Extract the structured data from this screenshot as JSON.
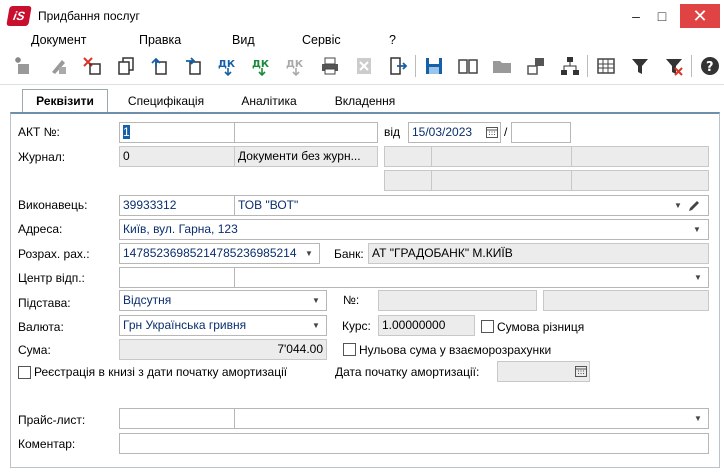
{
  "window": {
    "title": "Придбання послуг",
    "logo": "iS",
    "minimize": "–",
    "maximize": "□",
    "close": "✕"
  },
  "menu": [
    "Документ",
    "Правка",
    "Вид",
    "Сервіс",
    "?"
  ],
  "tabs": [
    "Реквізити",
    "Специфікація",
    "Аналітика",
    "Вкладення"
  ],
  "form": {
    "act_label": "АКТ №:",
    "act_value": "1",
    "act_value2": "",
    "date_label": "від",
    "date_value": "15/03/2023",
    "slash": "/",
    "date_extra": "",
    "journal_label": "Журнал:",
    "journal_code": "0",
    "journal_name": "Документи без журн...",
    "executor_label": "Виконавець:",
    "executor_code": "39933312",
    "executor_name": "ТОВ \"ВОТ\"",
    "address_label": "Адреса:",
    "address_value": "Київ, вул. Гарна, 123",
    "account_label": "Розрах. рах.:",
    "account_value": "14785236985214785236985214",
    "bank_label": "Банк:",
    "bank_value": "АТ  \"ГРАДОБАНК\" М.КИЇВ",
    "center_label": "Центр відп.:",
    "basis_label": "Підстава:",
    "basis_value": "Відсутня",
    "no_label": "№:",
    "currency_label": "Валюта:",
    "currency_value": "Грн Українська гривня",
    "rate_label": "Курс:",
    "rate_value": "1.00000000",
    "sum_diff_label": "Сумова різниця",
    "sum_label": "Сума:",
    "sum_value": "7'044.00",
    "zero_sum_label": "Нульова сума у взаєморозрахунки",
    "register_label": "Реєстрація в книзі з дати початку амортизації",
    "amort_date_label": "Дата початку амортизації:",
    "price_label": "Прайс-лист:",
    "comment_label": "Коментар:"
  },
  "colors": {
    "close": "#e04343",
    "tab_border": "#6f8fa8",
    "logo": "#c8102e",
    "text_blue": "#0a2e6e"
  }
}
